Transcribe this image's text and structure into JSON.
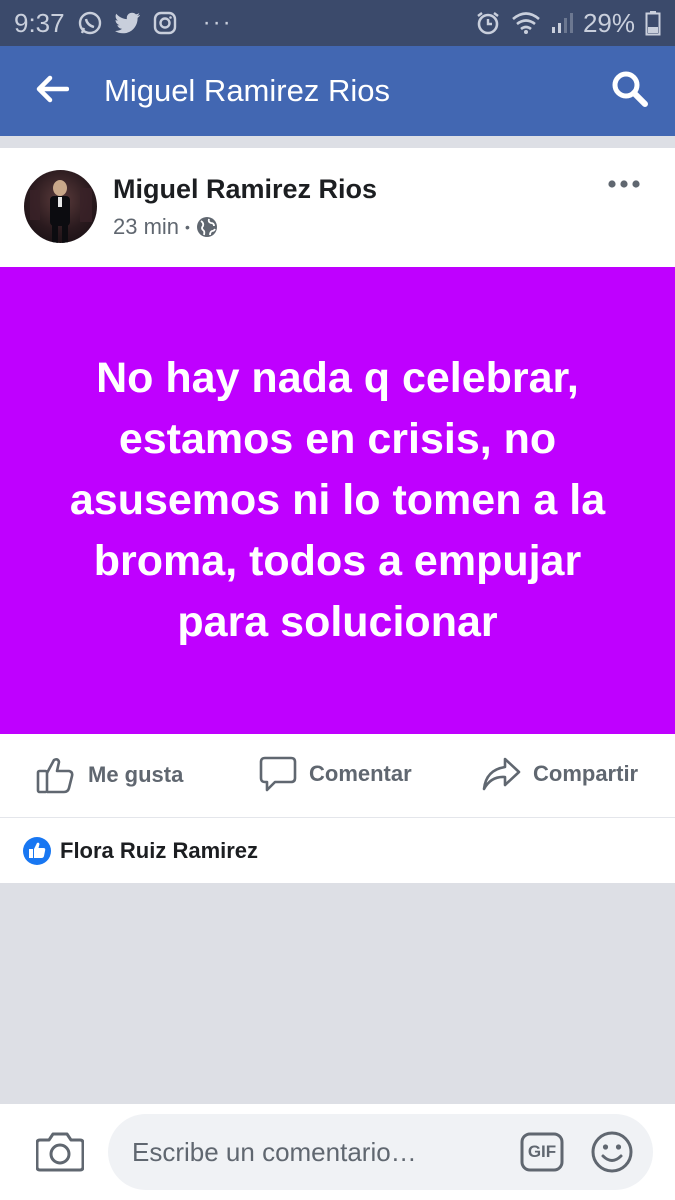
{
  "status_bar": {
    "time": "9:37",
    "battery": "29%",
    "more_dots": "···",
    "icons": [
      "whatsapp-icon",
      "twitter-icon",
      "instagram-icon",
      "alarm-icon",
      "wifi-icon",
      "signal-icon",
      "battery-icon"
    ]
  },
  "app_bar": {
    "title": "Miguel Ramirez Rios",
    "back_icon": "back-arrow-icon",
    "search_icon": "search-icon",
    "background": "#4267b2"
  },
  "post": {
    "author": "Miguel Ramirez Rios",
    "time": "23 min",
    "separator": "•",
    "privacy_icon": "globe-icon",
    "body_text": "No hay nada q celebrar, estamos en crisis, no asusemos ni lo tomen a la broma, todos a empujar para solucionar",
    "body_background": "#bf00ff",
    "actions": [
      {
        "label": "Me gusta",
        "icon": "thumbs-up-icon"
      },
      {
        "label": "Comentar",
        "icon": "comment-icon"
      },
      {
        "label": "Compartir",
        "icon": "share-icon"
      }
    ],
    "liked_by": "Flora Ruiz Ramirez"
  },
  "composer": {
    "placeholder": "Escribe un comentario…",
    "gif_label": "GIF",
    "icons": [
      "camera-icon",
      "gif-icon",
      "emoji-icon"
    ]
  }
}
